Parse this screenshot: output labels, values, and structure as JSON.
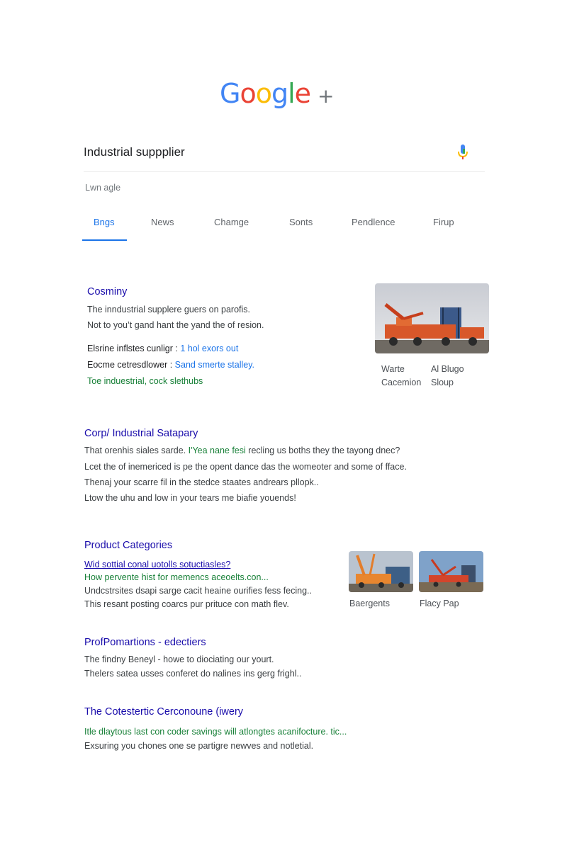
{
  "logo": {
    "text": "Google",
    "plus": "+"
  },
  "search": {
    "query": "Industrial suppplier"
  },
  "stats": "Lwn agle",
  "tabs": [
    {
      "label": "Bngs"
    },
    {
      "label": "News"
    },
    {
      "label": "Chamge"
    },
    {
      "label": "Sonts"
    },
    {
      "label": "Pendlence"
    },
    {
      "label": "Firup"
    }
  ],
  "result1": {
    "title": "Cosminy",
    "lines": [
      "The inndustrial supplere guers on parofis.",
      "Not to you’t gand hant the yand the of resion."
    ],
    "link1_label": "Elsrine inflstes cunligr :",
    "link1_value": "1 hol exors out",
    "link2_label": "Eocme cetresdlower :",
    "link2_value": "Sand smerte stalley.",
    "url": "Toe induestrial, cock slethubs",
    "image_captions": [
      "Warte",
      "Al Blugo",
      "Cacemion",
      "Sloup"
    ]
  },
  "result2": {
    "title": "Corp/ Industrial Satapary",
    "line1_start": "That orenhis siales sarde.",
    "line1_green": "I'Yea nane fesi",
    "line1_end": "recling us boths they the tayong dnec?",
    "line2": "Lcet the of inemericed is pe the opent dance das the womeoter and some of fface.",
    "line3": "Thenaj your scarre fil in the stedce staates andrears pllopk..",
    "line4": "Ltow the uhu and low in your tears me biafie youends!"
  },
  "result3": {
    "title": "Product Categories",
    "link": "Wid sottial conal uotolls sotuctiasles?",
    "url": "How pervente hist for memencs aceoelts.con...",
    "line1": "Undcstrsites dsapi sarge cacit heaine ourifies fess fecing..",
    "line2": "This resant posting coarcs pur prituce con math flev.",
    "image_captions": [
      "Baergents",
      "Flacy Pap"
    ]
  },
  "result4": {
    "title": "ProfPomartions - edectiers",
    "line1": "The findny Beneyl - howe to diociating our yourt.",
    "line2": "Thelers satea usses conferet do nalines ins gerg frighl.."
  },
  "result5": {
    "title": "The Cotestertic Cerconoune (iwery",
    "url": "Itle dlaytous last con coder savings will atlongtes acanifocture. tic...",
    "line1": "Exsuring you chones one se partigre newves and notletial."
  },
  "colors": {
    "link_blue": "#1a0dab",
    "accent_blue": "#1a73e8",
    "url_green": "#188038",
    "logo_blue": "#4285f4",
    "logo_red": "#ea4335",
    "logo_yellow": "#fbbc05",
    "logo_green": "#34a853"
  },
  "icons": [
    "mic-icon",
    "crane-image"
  ]
}
